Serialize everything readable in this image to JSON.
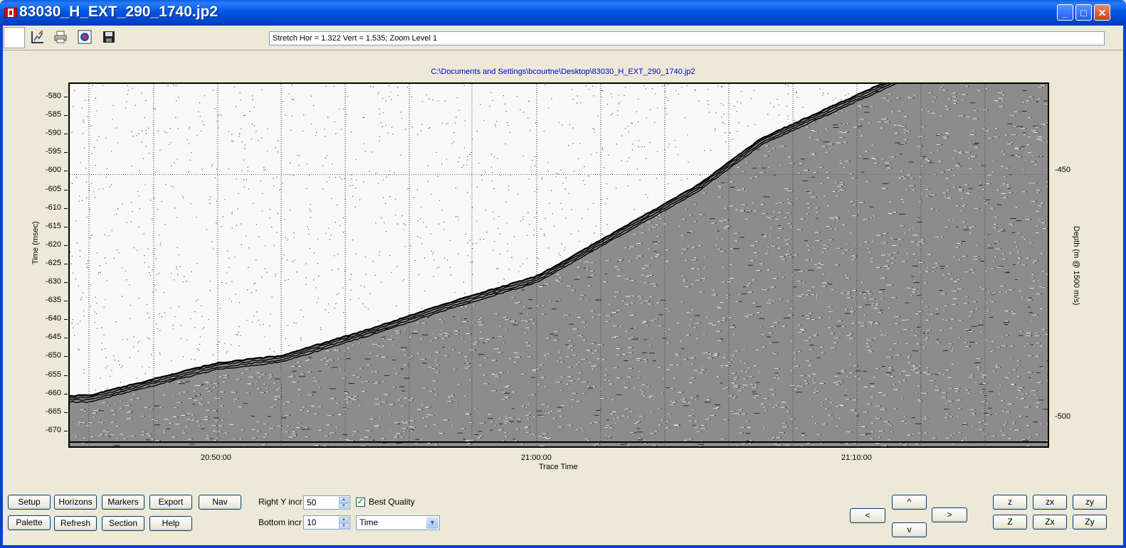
{
  "window": {
    "title": "83030_H_EXT_290_1740.jp2"
  },
  "toolbar": {
    "status": "Stretch Hor = 1.322 Vert = 1.535; Zoom Level 1"
  },
  "plot": {
    "file_path": "C:\\Documents and Settings\\bcourtne\\Desktop\\83030_H_EXT_290_1740.jp2",
    "y_axis_title": "Time (msec)",
    "y_right_title": "Depth (m @ 1500 m/s)",
    "x_axis_title": "Trace Time",
    "y_ticks": [
      "-580",
      "-585",
      "-590",
      "-595",
      "-600",
      "-605",
      "-610",
      "-615",
      "-620",
      "-625",
      "-630",
      "-635",
      "-640",
      "-645",
      "-650",
      "-655",
      "-660",
      "-665",
      "-670"
    ],
    "y_right_ticks": [
      "-450",
      "-500"
    ],
    "x_ticks": [
      "20:50:00",
      "21:00:00",
      "21:10:00"
    ]
  },
  "chart_data": {
    "type": "heatmap",
    "title": "C:\\Documents and Settings\\bcourtne\\Desktop\\83030_H_EXT_290_1740.jp2",
    "xlabel": "Trace Time",
    "ylabel": "Time (msec)",
    "y2label": "Depth (m @ 1500 m/s)",
    "ylim": [
      -675,
      -575
    ],
    "y2_ticks": [
      -450,
      -500
    ],
    "x_ticks": [
      "20:50:00",
      "21:00:00",
      "21:10:00"
    ],
    "grid": true,
    "seabed_profile": {
      "x": [
        "20:46:00",
        "20:50:00",
        "20:52:00",
        "20:55:00",
        "20:57:00",
        "21:00:00",
        "21:02:00",
        "21:05:00",
        "21:07:00",
        "21:10:00"
      ],
      "y": [
        -661,
        -652,
        -650,
        -642,
        -636,
        -628,
        -618,
        -603,
        -590,
        -578
      ]
    }
  },
  "controls": {
    "setup": "Setup",
    "horizons": "Horizons",
    "markers": "Markers",
    "export": "Export",
    "nav": "Nav",
    "palette": "Palette",
    "refresh": "Refresh",
    "section": "Section",
    "help": "Help",
    "right_y_label": "Right Y incr",
    "right_y_value": "50",
    "bottom_label": "Bottom  incr",
    "bottom_value": "10",
    "best_quality": "Best Quality",
    "axis_mode": "Time",
    "up": "^",
    "down": "v",
    "left": "<",
    "right": ">",
    "z_small": "z",
    "zx_small": "zx",
    "zy_small": "zy",
    "z_big": "Z",
    "zx_big": "Zx",
    "zy_big": "Zy"
  }
}
